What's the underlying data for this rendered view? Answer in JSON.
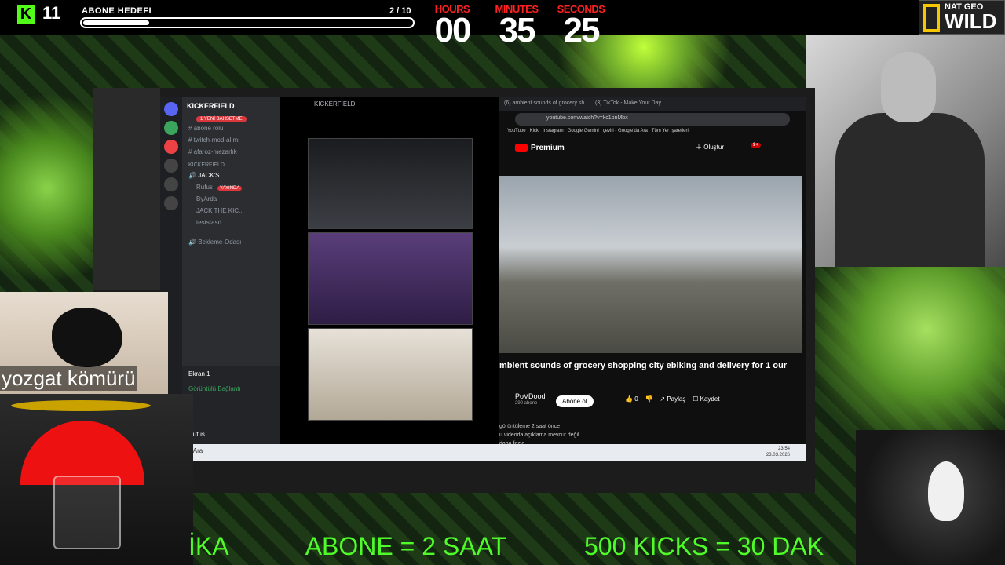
{
  "overlay": {
    "kick_count": "11",
    "goal_label": "ABONE HEDEFI",
    "goal_current": "2 / 10",
    "goal_fraction": 0.2,
    "timer": {
      "hours_label": "HOURS",
      "hours": "00",
      "minutes_label": "MINUTES",
      "minutes": "35",
      "seconds_label": "SECONDS",
      "seconds": "25"
    },
    "natgeo_top": "NAT GEO",
    "natgeo_bottom": "WILD",
    "rock_caption": "yozgat kömürü",
    "ticker": [
      "İKA",
      "ABONE = 2 SAAT",
      "500 KICKS = 30 DAK"
    ]
  },
  "discord": {
    "server_name": "KICKERFIELD",
    "window_title": "KICKERFIELD",
    "new_badge": "1 YENİ BAHSETME",
    "channels": [
      "abone rolü",
      "twitch-mod-alımı",
      "afaroz-mezarlık"
    ],
    "category": "KICKERFIELD",
    "voice_channel": "JACK'S...",
    "users": [
      "Rufus",
      "ByArda",
      "JACK THE KIC...",
      "teststasd"
    ],
    "live_label": "YAYINDA",
    "waiting": "Bekleme-Odası",
    "screen_label": "Ekran 1",
    "connection_status": "Görüntülü Bağlantı",
    "me": "Rufus"
  },
  "browser": {
    "tab1": "(6) ambient sounds of grocery sh...",
    "tab2": "(3) TikTok - Make Your Day",
    "url": "youtube.com/watch?v=kc1pnMbx",
    "bookmarks": [
      "YouTube",
      "Kick",
      "Instagram",
      "Google Gemini",
      "çeviri - Google'da Ara",
      "Tüm Yer İşaretleri"
    ],
    "yt_brand": "Premium",
    "create": "Oluştur",
    "notif_count": "9+",
    "video_title": "mbient sounds of grocery shopping city ebiking and delivery for 1 our",
    "channel": "PoVDood",
    "channel_subs": "290 abone",
    "subscribe": "Abone ol",
    "likes": "0",
    "share": "Paylaş",
    "save": "Kaydet",
    "views": "görüntüleme  2 saat önce",
    "desc": "u videoda açıklama mevcut değil",
    "more": "daha fazla"
  },
  "taskbar": {
    "search": "Ara",
    "time": "23:54",
    "date": "23.03.2026"
  }
}
